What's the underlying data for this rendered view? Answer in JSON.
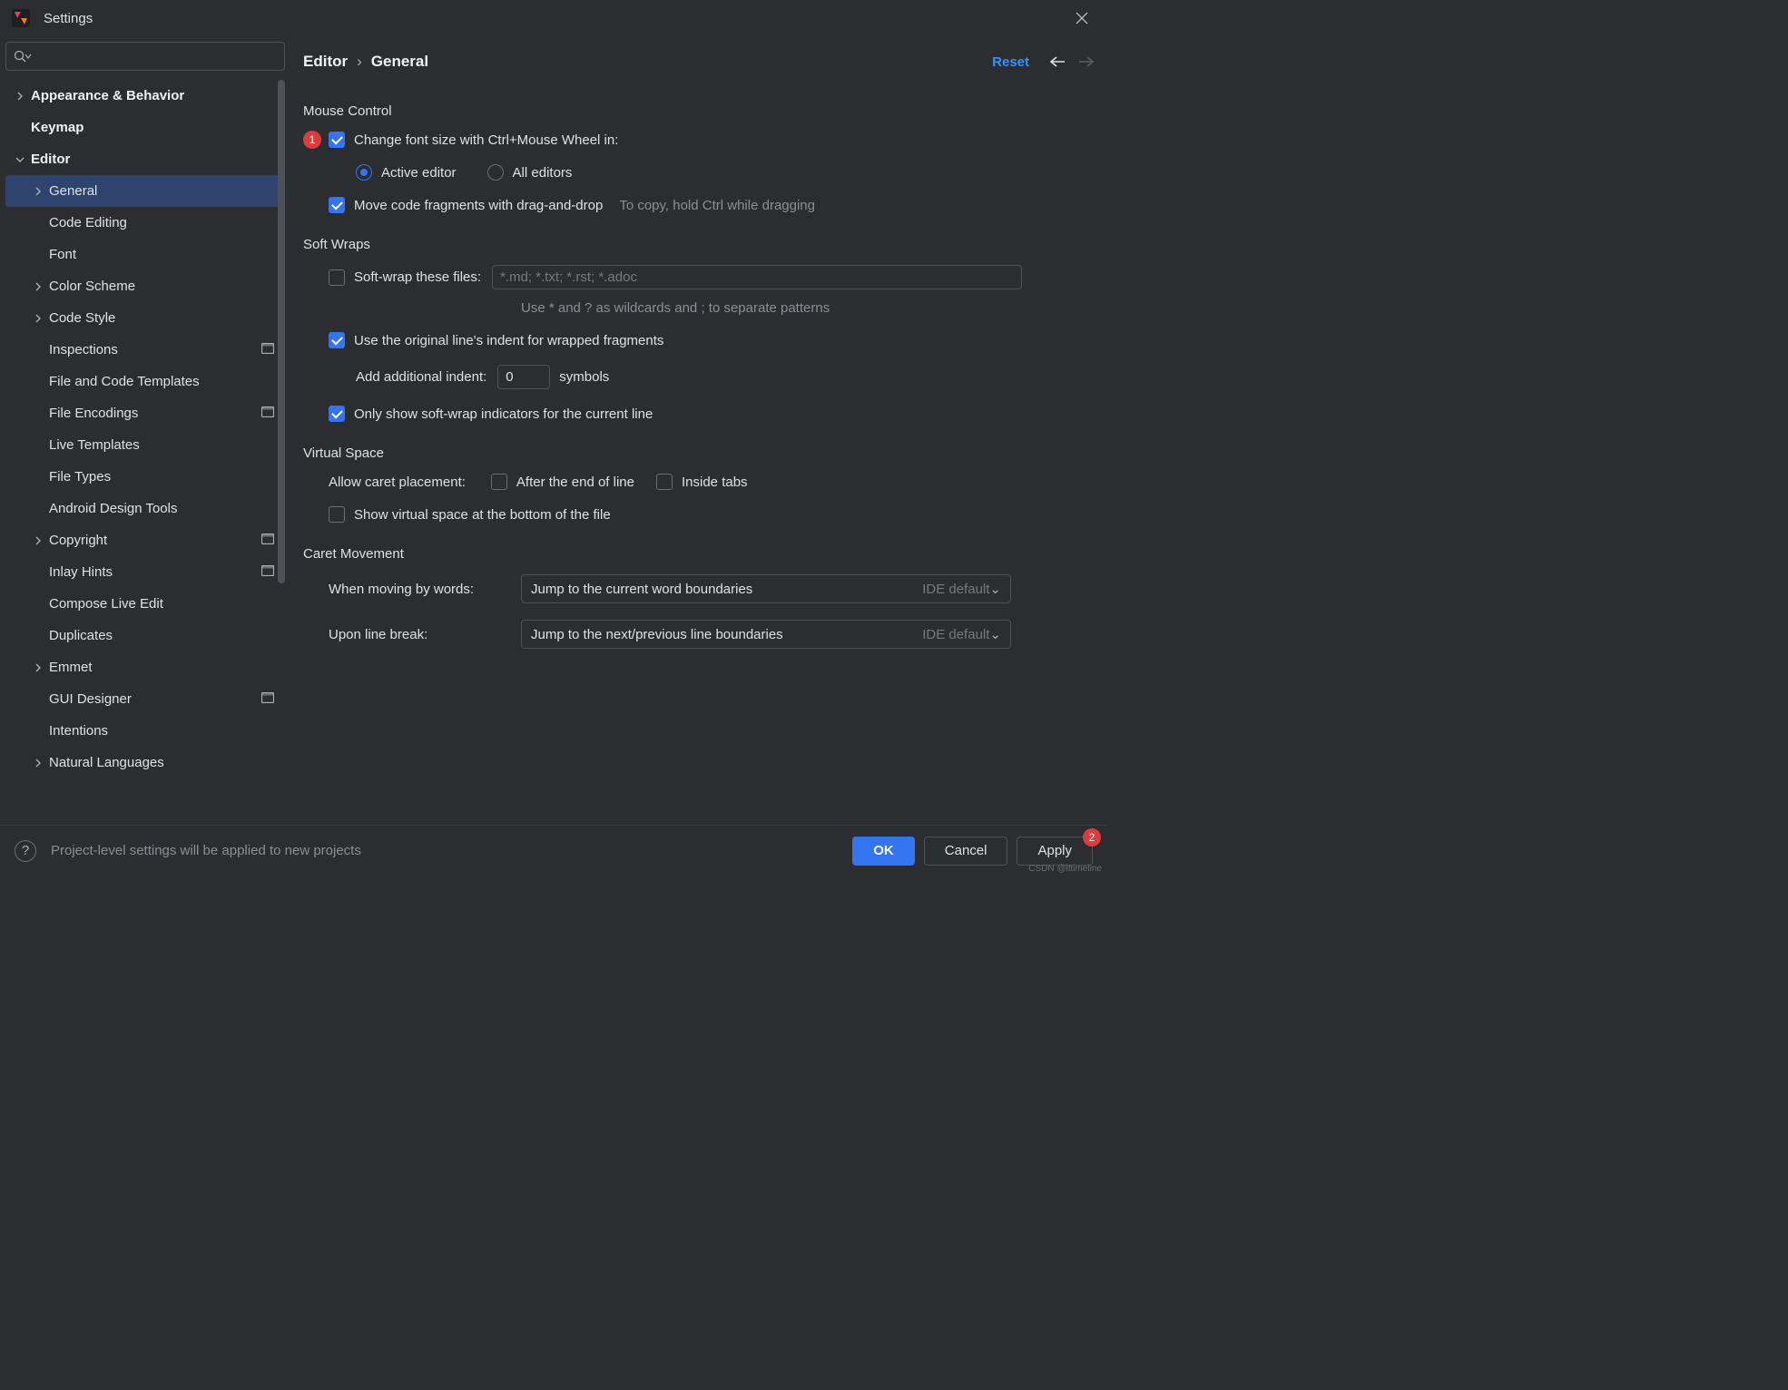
{
  "window": {
    "title": "Settings"
  },
  "breadcrumb": {
    "part1": "Editor",
    "part2": "General",
    "reset": "Reset"
  },
  "sidebar": {
    "items": [
      {
        "label": "Appearance & Behavior",
        "level": 0,
        "chev": "right",
        "bold": true
      },
      {
        "label": "Keymap",
        "level": 0,
        "chev": "",
        "bold": true
      },
      {
        "label": "Editor",
        "level": 0,
        "chev": "down",
        "bold": true
      },
      {
        "label": "General",
        "level": 1,
        "chev": "right",
        "selected": true
      },
      {
        "label": "Code Editing",
        "level": 1,
        "chev": ""
      },
      {
        "label": "Font",
        "level": 1,
        "chev": ""
      },
      {
        "label": "Color Scheme",
        "level": 1,
        "chev": "right"
      },
      {
        "label": "Code Style",
        "level": 1,
        "chev": "right"
      },
      {
        "label": "Inspections",
        "level": 1,
        "chev": "",
        "proj": true
      },
      {
        "label": "File and Code Templates",
        "level": 1,
        "chev": ""
      },
      {
        "label": "File Encodings",
        "level": 1,
        "chev": "",
        "proj": true
      },
      {
        "label": "Live Templates",
        "level": 1,
        "chev": ""
      },
      {
        "label": "File Types",
        "level": 1,
        "chev": ""
      },
      {
        "label": "Android Design Tools",
        "level": 1,
        "chev": ""
      },
      {
        "label": "Copyright",
        "level": 1,
        "chev": "right",
        "proj": true
      },
      {
        "label": "Inlay Hints",
        "level": 1,
        "chev": "",
        "proj": true
      },
      {
        "label": "Compose Live Edit",
        "level": 1,
        "chev": ""
      },
      {
        "label": "Duplicates",
        "level": 1,
        "chev": ""
      },
      {
        "label": "Emmet",
        "level": 1,
        "chev": "right"
      },
      {
        "label": "GUI Designer",
        "level": 1,
        "chev": "",
        "proj": true
      },
      {
        "label": "Intentions",
        "level": 1,
        "chev": ""
      },
      {
        "label": "Natural Languages",
        "level": 1,
        "chev": "right"
      }
    ]
  },
  "sections": {
    "mouse": {
      "title": "Mouse Control",
      "change_font": "Change font size with Ctrl+Mouse Wheel in:",
      "active_editor": "Active editor",
      "all_editors": "All editors",
      "move_fragments": "Move code fragments with drag-and-drop",
      "move_hint": "To copy, hold Ctrl while dragging",
      "badge1": "1"
    },
    "softwraps": {
      "title": "Soft Wraps",
      "wrap_files": "Soft-wrap these files:",
      "wrap_placeholder": "*.md; *.txt; *.rst; *.adoc",
      "wildcards_hint": "Use * and ? as wildcards and ; to separate patterns",
      "use_indent": "Use the original line's indent for wrapped fragments",
      "add_indent": "Add additional indent:",
      "indent_value": "0",
      "symbols": "symbols",
      "only_show": "Only show soft-wrap indicators for the current line"
    },
    "virtual": {
      "title": "Virtual Space",
      "allow_caret": "Allow caret placement:",
      "after_eol": "After the end of line",
      "inside_tabs": "Inside tabs",
      "show_virtual": "Show virtual space at the bottom of the file"
    },
    "caret": {
      "title": "Caret Movement",
      "by_words": "When moving by words:",
      "by_words_val": "Jump to the current word boundaries",
      "line_break": "Upon line break:",
      "line_break_val": "Jump to the next/previous line boundaries",
      "ide_default": "IDE default"
    }
  },
  "footer": {
    "hint": "Project-level settings will be applied to new projects",
    "ok": "OK",
    "cancel": "Cancel",
    "apply": "Apply",
    "apply_badge": "2",
    "watermark": "CSDN @ittimeline"
  }
}
